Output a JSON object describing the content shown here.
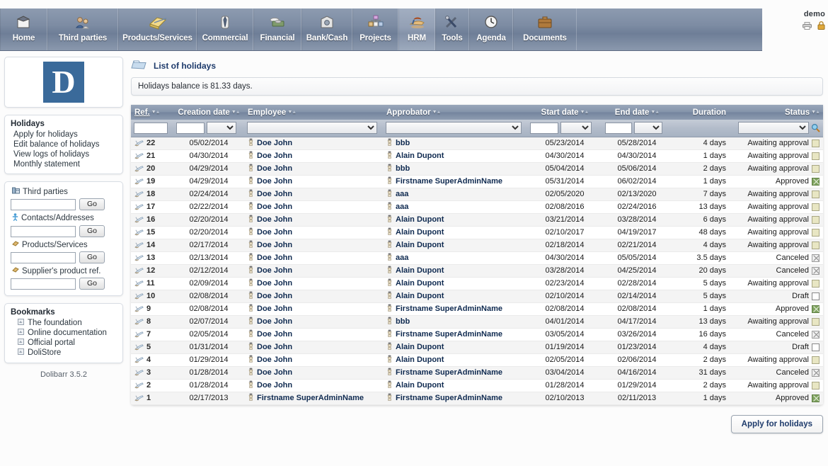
{
  "nav": {
    "items": [
      {
        "label": "Home",
        "icon": "home-icon",
        "active": false
      },
      {
        "label": "Third parties",
        "icon": "users-icon",
        "active": false
      },
      {
        "label": "Products/Services",
        "icon": "box-open-icon",
        "active": false
      },
      {
        "label": "Commercial",
        "icon": "tie-icon",
        "active": false
      },
      {
        "label": "Financial",
        "icon": "money-icon",
        "active": false
      },
      {
        "label": "Bank/Cash",
        "icon": "bank-icon",
        "active": false
      },
      {
        "label": "Projects",
        "icon": "project-icon",
        "active": false
      },
      {
        "label": "HRM",
        "icon": "beach-icon",
        "active": true
      },
      {
        "label": "Tools",
        "icon": "tools-icon",
        "active": false
      },
      {
        "label": "Agenda",
        "icon": "clock-icon",
        "active": false
      },
      {
        "label": "Documents",
        "icon": "briefcase-icon",
        "active": false
      }
    ]
  },
  "user": {
    "name": "demo",
    "icons": [
      "printer-icon",
      "lock-icon"
    ]
  },
  "sidebar": {
    "logo_letter": "D",
    "holidays": {
      "title": "Holidays",
      "links": [
        "Apply for holidays",
        "Edit balance of holidays",
        "View logs of holidays",
        "Monthly statement"
      ]
    },
    "search": {
      "groups": [
        {
          "label": "Third parties",
          "icon": "building-icon",
          "value": "",
          "button": "Go"
        },
        {
          "label": "Contacts/Addresses",
          "icon": "contact-icon",
          "value": "",
          "button": "Go"
        },
        {
          "label": "Products/Services",
          "icon": "product-icon",
          "value": "",
          "button": "Go"
        },
        {
          "label": "Supplier's product ref.",
          "icon": "product-icon",
          "value": "",
          "button": "Go"
        }
      ]
    },
    "bookmarks": {
      "title": "Bookmarks",
      "links": [
        "The foundation",
        "Online documentation",
        "Official portal",
        "DoliStore"
      ]
    },
    "version": "Dolibarr 3.5.2"
  },
  "page": {
    "title": "List of holidays",
    "title_icon": "folder-icon",
    "info": "Holidays balance is 81.33 days.",
    "info_value": "81.33",
    "apply_button": "Apply for holidays"
  },
  "table": {
    "columns": [
      {
        "label": "Ref.",
        "sortable": true,
        "sorted": true
      },
      {
        "label": "Creation date",
        "sortable": true
      },
      {
        "label": "Employee",
        "sortable": true
      },
      {
        "label": "Approbator",
        "sortable": true
      },
      {
        "label": "Start date",
        "sortable": true
      },
      {
        "label": "End date",
        "sortable": true
      },
      {
        "label": "Duration",
        "sortable": false
      },
      {
        "label": "Status",
        "sortable": true
      }
    ],
    "filters": {
      "ref": "",
      "creation_date_day": "",
      "creation_date_month": "",
      "employee": "",
      "approbator": "",
      "start_date_day": "",
      "start_date_month": "",
      "end_date_day": "",
      "end_date_month": "",
      "status": "",
      "search_icon": "magnifier-icon"
    },
    "rows": [
      {
        "ref": "22",
        "creation": "05/02/2014",
        "employee": "Doe John",
        "approbator": "bbb",
        "start": "05/23/2014",
        "end": "05/28/2014",
        "duration": "4 days",
        "status": "Awaiting approval",
        "status_kind": "wait"
      },
      {
        "ref": "21",
        "creation": "04/30/2014",
        "employee": "Doe John",
        "approbator": "Alain Dupont",
        "start": "04/30/2014",
        "end": "04/30/2014",
        "duration": "1 days",
        "status": "Awaiting approval",
        "status_kind": "wait"
      },
      {
        "ref": "20",
        "creation": "04/29/2014",
        "employee": "Doe John",
        "approbator": "bbb",
        "start": "05/04/2014",
        "end": "05/06/2014",
        "duration": "2 days",
        "status": "Awaiting approval",
        "status_kind": "wait"
      },
      {
        "ref": "19",
        "creation": "04/29/2014",
        "employee": "Doe John",
        "approbator": "Firstname SuperAdminName",
        "start": "05/31/2014",
        "end": "06/02/2014",
        "duration": "1 days",
        "status": "Approved",
        "status_kind": "appr"
      },
      {
        "ref": "18",
        "creation": "02/24/2014",
        "employee": "Doe John",
        "approbator": "aaa",
        "start": "02/05/2020",
        "end": "02/13/2020",
        "duration": "7 days",
        "status": "Awaiting approval",
        "status_kind": "wait"
      },
      {
        "ref": "17",
        "creation": "02/22/2014",
        "employee": "Doe John",
        "approbator": "aaa",
        "start": "02/08/2016",
        "end": "02/24/2016",
        "duration": "13 days",
        "status": "Awaiting approval",
        "status_kind": "wait"
      },
      {
        "ref": "16",
        "creation": "02/20/2014",
        "employee": "Doe John",
        "approbator": "Alain Dupont",
        "start": "03/21/2014",
        "end": "03/28/2014",
        "duration": "6 days",
        "status": "Awaiting approval",
        "status_kind": "wait"
      },
      {
        "ref": "15",
        "creation": "02/20/2014",
        "employee": "Doe John",
        "approbator": "Alain Dupont",
        "start": "02/10/2017",
        "end": "04/19/2017",
        "duration": "48 days",
        "status": "Awaiting approval",
        "status_kind": "wait"
      },
      {
        "ref": "14",
        "creation": "02/17/2014",
        "employee": "Doe John",
        "approbator": "Alain Dupont",
        "start": "02/18/2014",
        "end": "02/21/2014",
        "duration": "4 days",
        "status": "Awaiting approval",
        "status_kind": "wait"
      },
      {
        "ref": "13",
        "creation": "02/13/2014",
        "employee": "Doe John",
        "approbator": "aaa",
        "start": "04/30/2014",
        "end": "05/05/2014",
        "duration": "3.5 days",
        "status": "Canceled",
        "status_kind": "canc"
      },
      {
        "ref": "12",
        "creation": "02/12/2014",
        "employee": "Doe John",
        "approbator": "Alain Dupont",
        "start": "03/28/2014",
        "end": "04/25/2014",
        "duration": "20 days",
        "status": "Canceled",
        "status_kind": "canc"
      },
      {
        "ref": "11",
        "creation": "02/09/2014",
        "employee": "Doe John",
        "approbator": "Alain Dupont",
        "start": "02/23/2014",
        "end": "02/28/2014",
        "duration": "5 days",
        "status": "Awaiting approval",
        "status_kind": "wait"
      },
      {
        "ref": "10",
        "creation": "02/08/2014",
        "employee": "Doe John",
        "approbator": "Alain Dupont",
        "start": "02/10/2014",
        "end": "02/14/2014",
        "duration": "5 days",
        "status": "Draft",
        "status_kind": "draft"
      },
      {
        "ref": "9",
        "creation": "02/08/2014",
        "employee": "Doe John",
        "approbator": "Firstname SuperAdminName",
        "start": "02/08/2014",
        "end": "02/08/2014",
        "duration": "1 days",
        "status": "Approved",
        "status_kind": "appr"
      },
      {
        "ref": "8",
        "creation": "02/07/2014",
        "employee": "Doe John",
        "approbator": "bbb",
        "start": "04/01/2014",
        "end": "04/17/2014",
        "duration": "13 days",
        "status": "Awaiting approval",
        "status_kind": "wait"
      },
      {
        "ref": "7",
        "creation": "02/05/2014",
        "employee": "Doe John",
        "approbator": "Firstname SuperAdminName",
        "start": "03/05/2014",
        "end": "03/26/2014",
        "duration": "16 days",
        "status": "Canceled",
        "status_kind": "canc"
      },
      {
        "ref": "5",
        "creation": "01/31/2014",
        "employee": "Doe John",
        "approbator": "Alain Dupont",
        "start": "01/19/2014",
        "end": "01/23/2014",
        "duration": "4 days",
        "status": "Draft",
        "status_kind": "draft"
      },
      {
        "ref": "4",
        "creation": "01/29/2014",
        "employee": "Doe John",
        "approbator": "Alain Dupont",
        "start": "02/05/2014",
        "end": "02/06/2014",
        "duration": "2 days",
        "status": "Awaiting approval",
        "status_kind": "wait"
      },
      {
        "ref": "3",
        "creation": "01/28/2014",
        "employee": "Doe John",
        "approbator": "Firstname SuperAdminName",
        "start": "03/04/2014",
        "end": "04/16/2014",
        "duration": "31 days",
        "status": "Canceled",
        "status_kind": "canc"
      },
      {
        "ref": "2",
        "creation": "01/28/2014",
        "employee": "Doe John",
        "approbator": "Alain Dupont",
        "start": "01/28/2014",
        "end": "01/29/2014",
        "duration": "2 days",
        "status": "Awaiting approval",
        "status_kind": "wait"
      },
      {
        "ref": "1",
        "creation": "02/17/2013",
        "employee": "Firstname SuperAdminName",
        "approbator": "Firstname SuperAdminName",
        "start": "02/10/2013",
        "end": "02/11/2013",
        "duration": "1 days",
        "status": "Approved",
        "status_kind": "appr"
      }
    ]
  },
  "colors": {
    "nav_bg": "#7d8ca3",
    "header_bg": "#8494aa",
    "title": "#1d3a6b",
    "logo": "#3a6a9a",
    "status_wait": "#e8e6c3",
    "status_approved": "#7fa35f"
  }
}
